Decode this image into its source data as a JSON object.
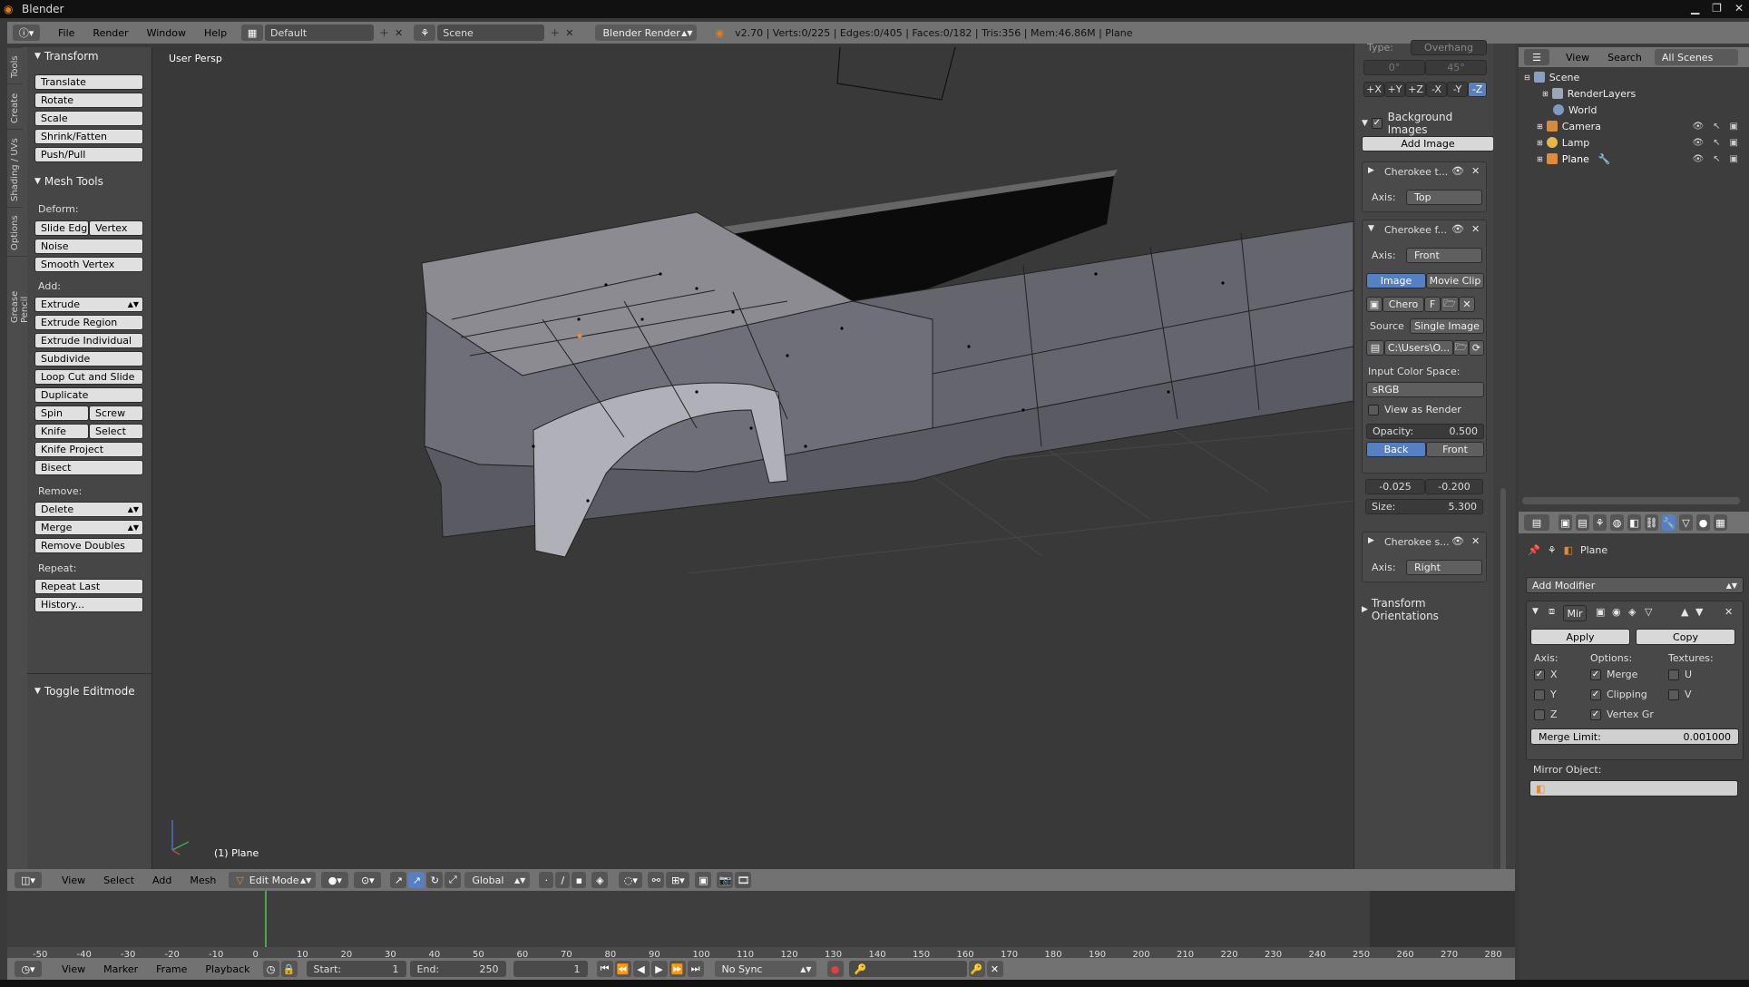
{
  "window": {
    "title": "Blender"
  },
  "topbar": {
    "menus": [
      "File",
      "Render",
      "Window",
      "Help"
    ],
    "layout": "Default",
    "scene": "Scene",
    "engine": "Blender Render",
    "stats": "v2.70 | Verts:0/225 | Edges:0/405 | Faces:0/182 | Tris:356 | Mem:46.86M | Plane"
  },
  "toolstrip": {
    "tabs": [
      "Tools",
      "Create",
      "Shading / UVs",
      "Options",
      "Grease Pencil"
    ]
  },
  "toolshelf": {
    "transform": {
      "title": "Transform",
      "items": [
        "Translate",
        "Rotate",
        "Scale",
        "Shrink/Fatten",
        "Push/Pull"
      ]
    },
    "mesh_tools": {
      "title": "Mesh Tools",
      "deform_label": "Deform:",
      "slide_edge": "Slide Edg",
      "vertex": "Vertex",
      "noise": "Noise",
      "smooth_vertex": "Smooth Vertex",
      "add_label": "Add:",
      "extrude": "Extrude",
      "extrude_region": "Extrude Region",
      "extrude_individual": "Extrude Individual",
      "subdivide": "Subdivide",
      "loop_cut": "Loop Cut and Slide",
      "duplicate": "Duplicate",
      "spin": "Spin",
      "screw": "Screw",
      "knife": "Knife",
      "select": "Select",
      "knife_project": "Knife Project",
      "bisect": "Bisect",
      "remove_label": "Remove:",
      "delete": "Delete",
      "merge": "Merge",
      "remove_doubles": "Remove Doubles",
      "repeat_label": "Repeat:",
      "repeat_last": "Repeat Last",
      "history": "History..."
    },
    "toggle_editmode": "Toggle Editmode"
  },
  "viewport": {
    "view_label": "User Persp",
    "object_label": "(1) Plane"
  },
  "npanel": {
    "type_label": "Type:",
    "type_value": "Overhang",
    "angle_a": "0°",
    "angle_b": "45°",
    "axis_buttons": [
      "+X",
      "+Y",
      "+Z",
      "-X",
      "-Y",
      "-Z"
    ],
    "background_images": "Background Images",
    "add_image": "Add Image",
    "bg1": {
      "name": "Cherokee t...",
      "axis_label": "Axis:",
      "axis": "Top"
    },
    "bg2": {
      "name": "Cherokee f...",
      "axis_label": "Axis:",
      "axis": "Front",
      "tab_image": "Image",
      "tab_movie": "Movie Clip",
      "image_name": "Chero",
      "fake": "F",
      "source_label": "Source",
      "source": "Single Image",
      "path": "C:\\Users\\O...",
      "color_space_label": "Input Color Space:",
      "color_space": "sRGB",
      "view_as_render": "View as Render",
      "opacity_label": "Opacity:",
      "opacity": "0.500",
      "back": "Back",
      "front": "Front",
      "offset_x": "-0.025",
      "offset_y": "-0.200",
      "size_label": "Size:",
      "size": "5.300"
    },
    "bg3": {
      "name": "Cherokee s...",
      "axis_label": "Axis:",
      "axis": "Right"
    },
    "transform_orientations": "Transform Orientations"
  },
  "outliner": {
    "menus": [
      "View",
      "Search"
    ],
    "filter": "All Scenes",
    "items": [
      {
        "label": "Scene",
        "color": "#8a9fbf"
      },
      {
        "label": "RenderLayers",
        "color": "#9aa7b7"
      },
      {
        "label": "World",
        "color": "#7f9ac0"
      },
      {
        "label": "Camera",
        "color": "#d78a3c"
      },
      {
        "label": "Lamp",
        "color": "#e3b84a"
      },
      {
        "label": "Plane",
        "color": "#e08b3a"
      }
    ]
  },
  "properties": {
    "context_object": "Plane",
    "add_modifier": "Add Modifier",
    "modifier_name": "Mir",
    "apply": "Apply",
    "copy": "Copy",
    "axis_label": "Axis:",
    "options_label": "Options:",
    "textures_label": "Textures:",
    "axis_x": "X",
    "axis_y": "Y",
    "axis_z": "Z",
    "opt_merge": "Merge",
    "opt_clipping": "Clipping",
    "opt_vertex": "Vertex Gr",
    "tex_u": "U",
    "tex_v": "V",
    "merge_limit_label": "Merge Limit:",
    "merge_limit": "0.001000",
    "mirror_object_label": "Mirror Object:"
  },
  "viewport_header": {
    "menus": [
      "View",
      "Select",
      "Add",
      "Mesh"
    ],
    "mode": "Edit Mode",
    "orientation": "Global"
  },
  "timeline": {
    "ticks": [
      "-50",
      "-40",
      "-30",
      "-20",
      "-10",
      "0",
      "10",
      "20",
      "30",
      "40",
      "50",
      "60",
      "70",
      "80",
      "90",
      "100",
      "110",
      "120",
      "130",
      "140",
      "150",
      "160",
      "170",
      "180",
      "190",
      "200",
      "210",
      "220",
      "230",
      "240",
      "250",
      "260",
      "270",
      "280"
    ],
    "menus": [
      "View",
      "Marker",
      "Frame",
      "Playback"
    ],
    "start_label": "Start:",
    "start": "1",
    "end_label": "End:",
    "end": "250",
    "current": "1",
    "sync": "No Sync"
  },
  "colors": {
    "accent_blue": "#5680c2",
    "header_gray": "#727272",
    "panel_bg": "#464646",
    "viewport_bg": "#393939"
  }
}
